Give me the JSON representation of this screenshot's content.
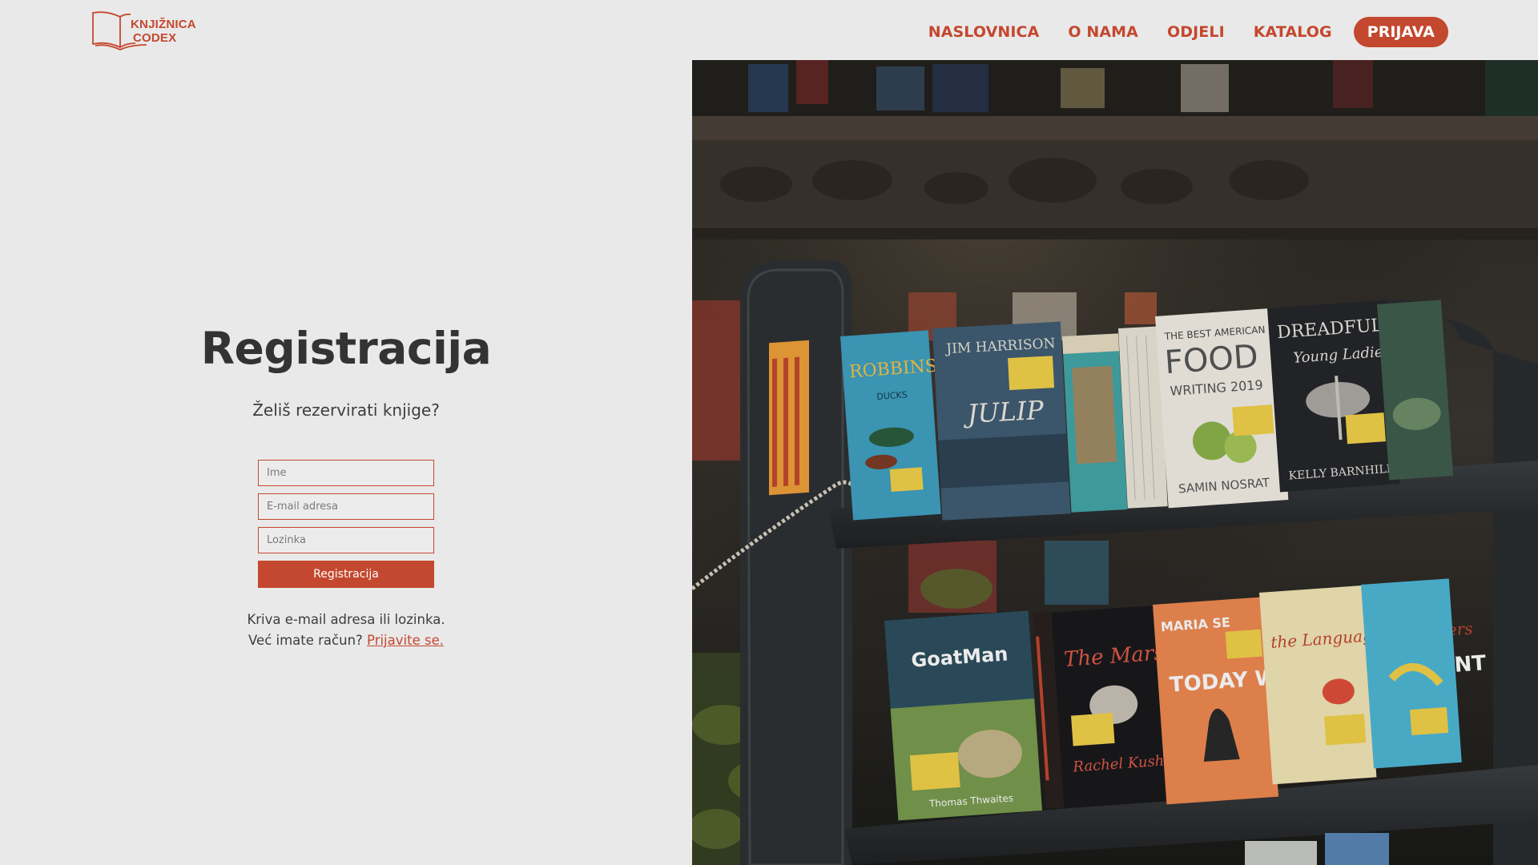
{
  "brand": {
    "line1": "KNJIŽNICA",
    "line2": "CODEX",
    "color": "#c4482f"
  },
  "nav": {
    "items": [
      {
        "label": "NASLOVNICA"
      },
      {
        "label": "O NAMA"
      },
      {
        "label": "ODJELI"
      },
      {
        "label": "KATALOG"
      }
    ],
    "cta": "PRIJAVA"
  },
  "form": {
    "title": "Registracija",
    "subtitle": "Želiš rezervirati knjige?",
    "name_placeholder": "Ime",
    "email_placeholder": "E-mail adresa",
    "password_placeholder": "Lozinka",
    "submit_label": "Registracija",
    "error": "Kriva e-mail adresa ili lozinka.",
    "have_account": "Već imate račun?",
    "login_link": "Prijavite se."
  },
  "hero": {
    "books": [
      {
        "title": "JIM HARRISON"
      },
      {
        "title": "JULIP"
      },
      {
        "title": "THE BEST AMERICAN"
      },
      {
        "title": "FOOD"
      },
      {
        "title": "WRITING 2019"
      },
      {
        "title": "SAMIN NOSRAT"
      },
      {
        "title": "DREADFUL"
      },
      {
        "title": "Young Ladies"
      },
      {
        "title": "KELLY BARNHILL"
      },
      {
        "title": "GoatMan"
      },
      {
        "title": "Thomas Thwaites"
      },
      {
        "title": "The Mars Room"
      },
      {
        "title": "Rachel Kushner"
      },
      {
        "title": "TODAY WILL BE DIFFERENT"
      },
      {
        "title": "MARIA SE"
      },
      {
        "title": "the Language of Flowers"
      },
      {
        "title": "ROBBINS"
      },
      {
        "title": "DUCKS"
      }
    ]
  },
  "colors": {
    "accent": "#c4482f",
    "background": "#e9e9e9",
    "text": "#333333"
  }
}
